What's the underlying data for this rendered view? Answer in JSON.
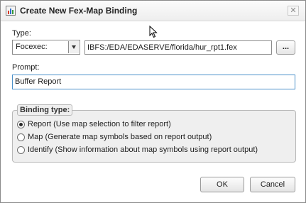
{
  "window": {
    "title": "Create New Fex-Map Binding",
    "close_label": "✕"
  },
  "type_field": {
    "label": "Type:",
    "selected": "Focexec:",
    "path": "IBFS:/EDA/EDASERVE/florida/hur_rpt1.fex",
    "browse_label": "..."
  },
  "prompt_field": {
    "label": "Prompt:",
    "value": "Buffer Report"
  },
  "binding_type": {
    "legend": "Binding type:",
    "options": [
      {
        "label": "Report (Use map selection to filter report)",
        "checked": true
      },
      {
        "label": "Map (Generate map symbols based on report output)",
        "checked": false
      },
      {
        "label": "Identify (Show information about map symbols using report output)",
        "checked": false
      }
    ]
  },
  "buttons": {
    "ok": "OK",
    "cancel": "Cancel"
  }
}
